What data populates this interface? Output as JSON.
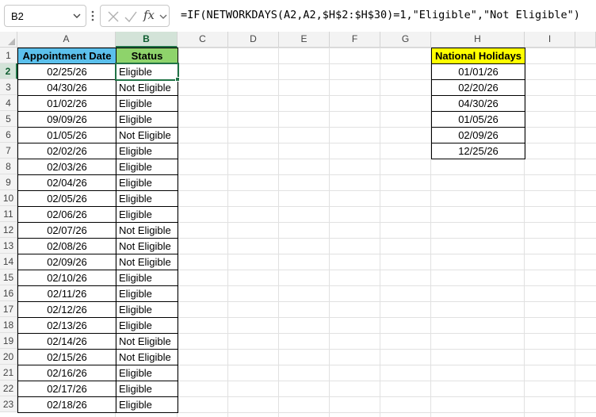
{
  "name_box": {
    "value": "B2"
  },
  "formula_bar": {
    "fx_label": "fx",
    "formula": "=IF(NETWORKDAYS(A2,A2,$H$2:$H$30)=1,\"Eligible\",\"Not Eligible\")"
  },
  "columns": [
    "A",
    "B",
    "C",
    "D",
    "E",
    "F",
    "G",
    "H",
    "I"
  ],
  "rows": [
    "1",
    "2",
    "3",
    "4",
    "5",
    "6",
    "7",
    "8",
    "9",
    "10",
    "11",
    "12",
    "13",
    "14",
    "15",
    "16",
    "17",
    "18",
    "19",
    "20",
    "21",
    "22",
    "23"
  ],
  "table": {
    "header_date": "Appointment Date",
    "header_status": "Status",
    "records": [
      {
        "date": "02/25/26",
        "status": "Eligible"
      },
      {
        "date": "04/30/26",
        "status": "Not Eligible"
      },
      {
        "date": "01/02/26",
        "status": "Eligible"
      },
      {
        "date": "09/09/26",
        "status": "Eligible"
      },
      {
        "date": "01/05/26",
        "status": "Not Eligible"
      },
      {
        "date": "02/02/26",
        "status": "Eligible"
      },
      {
        "date": "02/03/26",
        "status": "Eligible"
      },
      {
        "date": "02/04/26",
        "status": "Eligible"
      },
      {
        "date": "02/05/26",
        "status": "Eligible"
      },
      {
        "date": "02/06/26",
        "status": "Eligible"
      },
      {
        "date": "02/07/26",
        "status": "Not Eligible"
      },
      {
        "date": "02/08/26",
        "status": "Not Eligible"
      },
      {
        "date": "02/09/26",
        "status": "Not Eligible"
      },
      {
        "date": "02/10/26",
        "status": "Eligible"
      },
      {
        "date": "02/11/26",
        "status": "Eligible"
      },
      {
        "date": "02/12/26",
        "status": "Eligible"
      },
      {
        "date": "02/13/26",
        "status": "Eligible"
      },
      {
        "date": "02/14/26",
        "status": "Not Eligible"
      },
      {
        "date": "02/15/26",
        "status": "Not Eligible"
      },
      {
        "date": "02/16/26",
        "status": "Eligible"
      },
      {
        "date": "02/17/26",
        "status": "Eligible"
      },
      {
        "date": "02/18/26",
        "status": "Eligible"
      }
    ]
  },
  "holidays": {
    "header": "National Holidays",
    "dates": [
      "01/01/26",
      "02/20/26",
      "04/30/26",
      "01/05/26",
      "02/09/26",
      "12/25/26"
    ]
  },
  "colors": {
    "header_date_fill": "#5bc0ec",
    "header_status_fill": "#8ed36b",
    "header_holidays_fill": "#ffff00",
    "selection": "#217346"
  },
  "selected_cell": "B2"
}
